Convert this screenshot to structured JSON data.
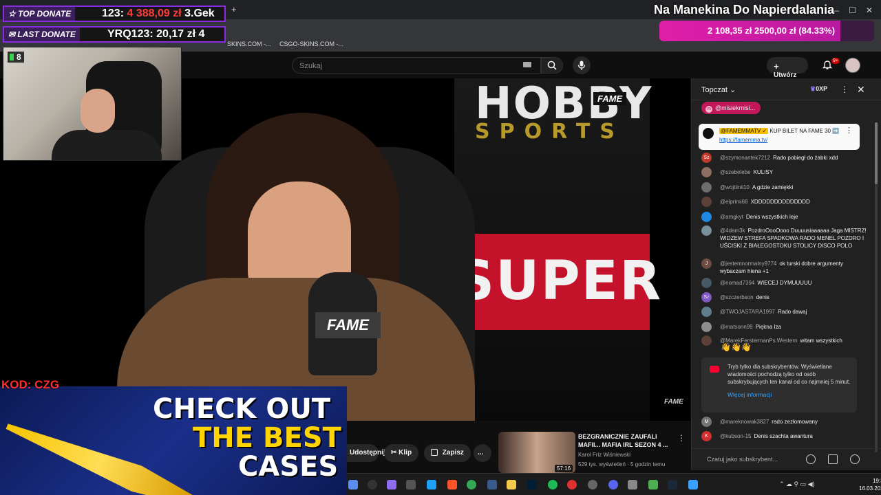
{
  "browser": {
    "new_tab": "+",
    "bookmarks": [
      "SKINS.COM -...",
      "CSGO-SKINS.COM -..."
    ]
  },
  "youtube": {
    "search_placeholder": "Szukaj",
    "create_label": "Utwórz",
    "notif_badge": "9+"
  },
  "overlay": {
    "top_donate_label": "TOP DONATE",
    "top_donate_value_prefix": "123:",
    "top_donate_amount": "4 388,09 zł",
    "top_donate_rank": "3.Gek",
    "last_donate_label": "LAST DONATE",
    "last_donate_value": "YRQ123: 20,17 zł 4",
    "goal_title": "Na Manekina Do Napierdalania",
    "goal_current": "2 108,35 zł",
    "goal_target": "2500,00 zł",
    "goal_percent": "(84.33%)",
    "goal_fraction": 0.8433,
    "cam_badge": "8",
    "promo_code": "KOD: CZG",
    "promo_line1": "CHECK OUT",
    "promo_line2": "THE BEST",
    "promo_line3": "CASES"
  },
  "video": {
    "sign_top": "HOBBY",
    "sign_sub": "SPORTS",
    "fame_tag": "FAME",
    "screen_text": "SUPER",
    "mic_text": "FAME",
    "corner_logo": "FAME"
  },
  "below_video": {
    "share_label": "Udostępnij",
    "clip_label": "Klip",
    "save_label": "Zapisz",
    "more_label": "...",
    "related": {
      "title": "BEZGRANICZNIE ZAUFALI MAFII... MAFIA IRL SEZON 4 ...",
      "channel": "Karol Friz Wiśniewski",
      "meta": "529 tys. wyświetleń · 5 godzin temu",
      "duration": "57:16"
    }
  },
  "chat": {
    "title": "Topczat",
    "xp": "0XP",
    "mention": "@misiekmisi...",
    "mention_initial": "m",
    "pinned": {
      "author": "@FAMEMMATV ✓",
      "text": "KUP BILET NA FAME 30 ➡️",
      "link": "https://famemma.tv/"
    },
    "messages": [
      {
        "initial": "Sz",
        "color": "#c0392b",
        "name": "@szymonantek7212",
        "text": "Rado pobiegł do żabki xdd"
      },
      {
        "initial": "",
        "color": "#8d6e63",
        "name": "@szebelebe",
        "text": "KULISY"
      },
      {
        "initial": "",
        "color": "#6d6d6d",
        "name": "@wojtiinii10",
        "text": "A gdzie zamiękki"
      },
      {
        "initial": "",
        "color": "#5d4037",
        "name": "@elprimi68",
        "text": "XDDDDDDDDDDDDDD"
      },
      {
        "initial": "",
        "color": "#1e88e5",
        "name": "@amgkyt",
        "text": "Denis wszystkich leje"
      },
      {
        "initial": "",
        "color": "#78909c",
        "name": "@4dam3k",
        "text": "PozdroOooOooo Duuuusiaaaaaa Jaga MISTRZ! WIDZEW STREFA SPADKOWA RADO MENEL POZDRO I UŚCISKI Z BIAŁEGOSTOKU STOLICY DISCO POLO"
      },
      {
        "initial": "J",
        "color": "#6d4c41",
        "name": "@jestemnormalny9774",
        "text": "ok turski dobre argumenty wybaczam hiena +1"
      },
      {
        "initial": "",
        "color": "#455a64",
        "name": "@nomad7394",
        "text": "WIECEJ DYMUUUUU"
      },
      {
        "initial": "Sz",
        "color": "#7e57c2",
        "name": "@szczerbson",
        "text": "denis"
      },
      {
        "initial": "",
        "color": "#607d8b",
        "name": "@TWOJASTARA1997",
        "text": "Rado dawaj"
      },
      {
        "initial": "",
        "color": "#8e8e8e",
        "name": "@matsonn99",
        "text": "Piękna Iza"
      },
      {
        "initial": "",
        "color": "#5d4037",
        "name": "@MarekFerstermanPs.Western",
        "text": "witam wszystkich"
      }
    ],
    "hands": "👋👋👋",
    "submode_text": "Tryb tylko dla subskrybentów. Wyświetlane wiadomości pochodzą tylko od osób subskrybujących ten kanał od co najmniej 5 minut.",
    "submode_link": "Więcej informacji",
    "late_messages": [
      {
        "initial": "M",
        "color": "#757575",
        "name": "@mareknowak3827",
        "text": "rado zezłomowany"
      },
      {
        "initial": "K",
        "color": "#d32f2f",
        "name": "@kubson-15",
        "text": "Denis szachta awantura"
      }
    ],
    "input_placeholder": "Czatuj jako subskrybent..."
  },
  "taskbar": {
    "time": "19:32",
    "date": "16.03.2026"
  }
}
